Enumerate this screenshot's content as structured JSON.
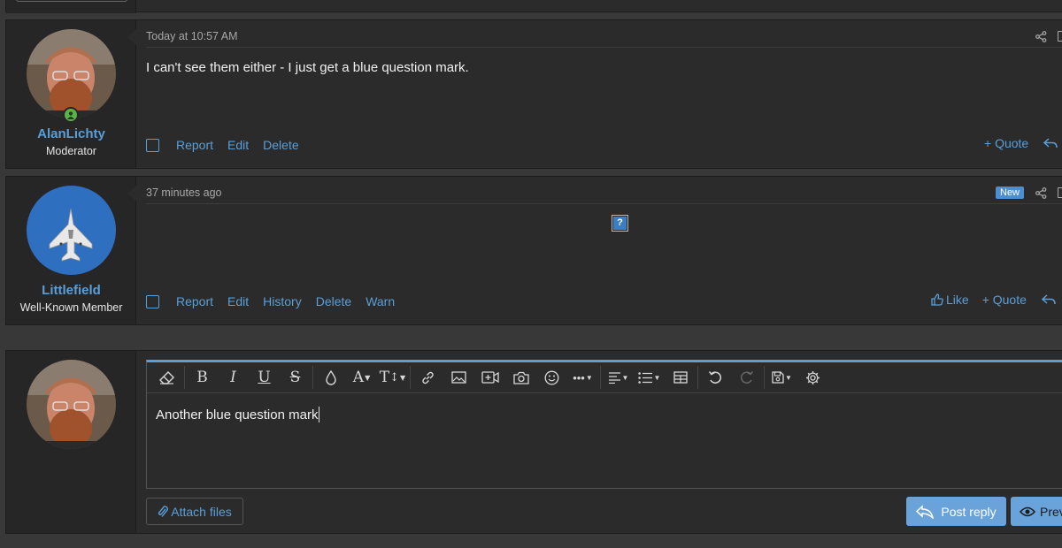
{
  "posts": [
    {
      "username": "AlanLichty",
      "user_title": "Moderator",
      "date": "Today at 10:57 AM",
      "body": "I can't see them either - I just get a blue question mark.",
      "actions": [
        "Report",
        "Edit",
        "Delete"
      ],
      "right_actions": [
        "+ Quote"
      ]
    },
    {
      "username": "Littlefield",
      "user_title": "Well-Known Member",
      "date": "37 minutes ago",
      "badge": "New",
      "broken_image_glyph": "?",
      "actions": [
        "Report",
        "Edit",
        "History",
        "Delete",
        "Warn"
      ],
      "right_actions": [
        "Like",
        "+ Quote"
      ]
    }
  ],
  "reply": {
    "editor_text": "Another blue question mark",
    "attach_label": "Attach files",
    "post_reply_label": "Post reply",
    "preview_label": "Prev"
  },
  "toolbar_icons": [
    "eraser-icon",
    "bold-icon",
    "italic-icon",
    "underline-icon",
    "strikethrough-icon",
    "text-color-icon",
    "font-family-icon",
    "font-size-icon",
    "link-icon",
    "image-icon",
    "video-icon",
    "camera-icon",
    "emoji-icon",
    "more-icon",
    "align-icon",
    "list-icon",
    "table-icon",
    "undo-icon",
    "redo-icon",
    "drafts-icon",
    "settings-icon"
  ],
  "colors": {
    "accent": "#5a9fd8",
    "background": "#2b2b2b",
    "online": "#5ab548",
    "button": "#6aa3d9"
  }
}
